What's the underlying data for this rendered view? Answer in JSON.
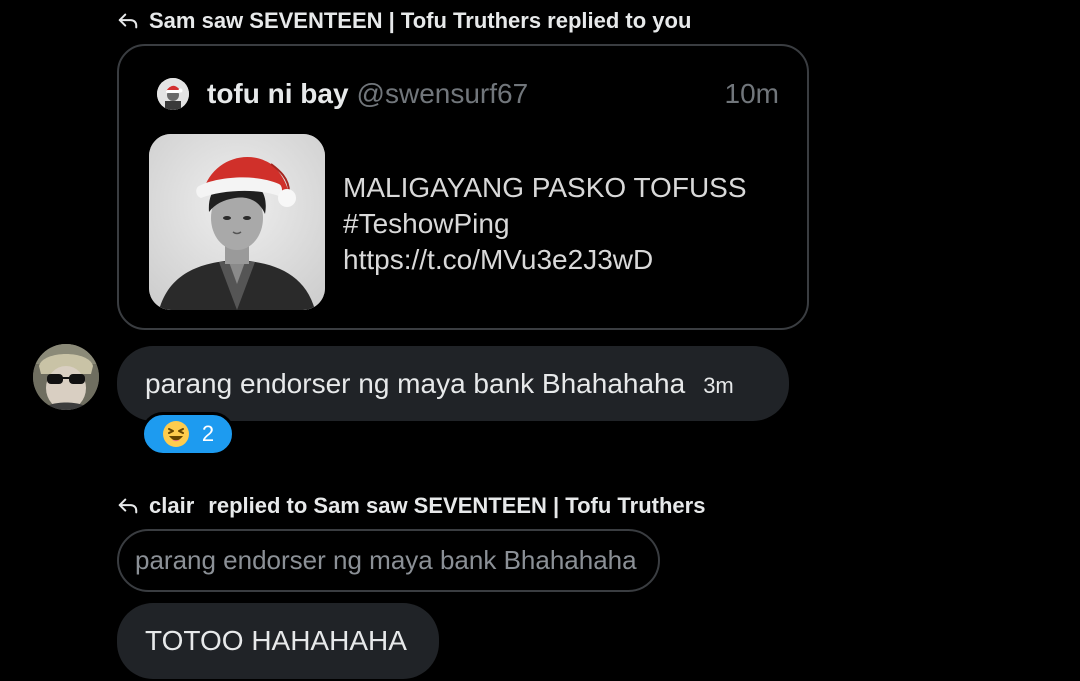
{
  "colors": {
    "background": "#000000",
    "bubble": "#202327",
    "border": "#3a3d41",
    "muted_text": "#71767b",
    "reaction_bg": "#1d9bf0"
  },
  "thread": {
    "reply_context_1": {
      "icon": "reply-arrow-icon",
      "text": "Sam saw SEVENTEEN | Tofu Truthers replied to you"
    },
    "quote_card": {
      "author_name": "tofu ni bay",
      "author_handle": "@swensurf67",
      "time": "10m",
      "text": "MALIGAYANG PASKO TOFUSS\n#TeshowPing\nhttps://t.co/MVu3e2J3wD"
    },
    "message_1": {
      "text": "parang endorser ng maya bank Bhahahaha",
      "time": "3m",
      "reaction": {
        "emoji": "laughing-emoji-icon",
        "count": "2"
      }
    },
    "reply_context_2": {
      "icon": "reply-arrow-icon",
      "who": "clair",
      "text": "replied to Sam saw SEVENTEEN | Tofu Truthers"
    },
    "quoted_reply": {
      "text": "parang endorser ng maya bank Bhahahaha"
    },
    "message_2": {
      "text": "TOTOO HAHAHAHA"
    }
  }
}
